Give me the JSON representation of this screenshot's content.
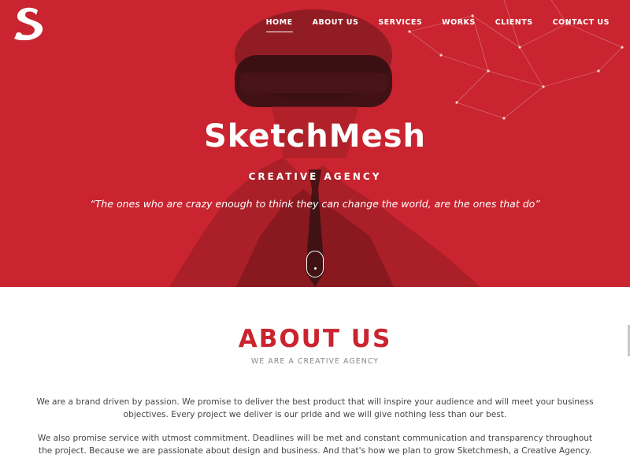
{
  "brand": {
    "logo_letter": "S",
    "accent_color": "#c9242f"
  },
  "nav": {
    "items": [
      {
        "label": "HOME",
        "active": true
      },
      {
        "label": "ABOUT US",
        "active": false
      },
      {
        "label": "SERVICES",
        "active": false
      },
      {
        "label": "WORKS",
        "active": false
      },
      {
        "label": "CLIENTS",
        "active": false
      },
      {
        "label": "CONTACT US",
        "active": false
      }
    ]
  },
  "hero": {
    "title": "SketchMesh",
    "subtitle": "CREATIVE AGENCY",
    "quote": "“The ones who are crazy enough to think they can change the world, are the ones that do”",
    "scroll_icon": "mouse-scroll-icon"
  },
  "about": {
    "title": "ABOUT US",
    "subtitle": "WE ARE A CREATIVE AGENCY",
    "paragraph1": "We are a brand driven by passion. We promise to deliver the best product that will inspire your audience and will meet your business objectives. Every project we deliver is our pride and we will give nothing less than our best.",
    "paragraph2": "We also promise service with utmost commitment. Deadlines will be met and constant communication and transparency throughout the project. Because we are passionate about design and business. And that's how we plan to grow Sketchmesh, a Creative Agency."
  }
}
